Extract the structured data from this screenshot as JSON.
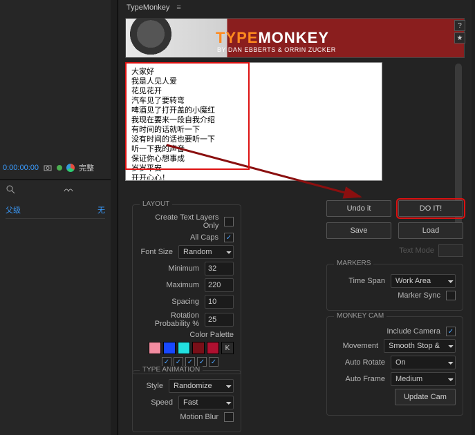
{
  "header": {
    "title": "TypeMonkey"
  },
  "banner": {
    "title_left": "TYPE",
    "title_right": "MONKEY",
    "subtitle": "BY DAN EBBERTS & ORRIN ZUCKER",
    "help": "?",
    "star": "★"
  },
  "text_content": "大家好\n我是人见人爱\n花见花开\n汽车见了要转弯\n啤酒见了打开盖的小魔红\n我现在要来一段自我介绍\n有时间的话就听一下\n没有时间的话也要听一下\n听一下我的声音\n保证你心想事成\n岁岁平安\n开开心心！",
  "layout": {
    "title": "LAYOUT",
    "create_layers_label": "Create Text Layers Only",
    "all_caps_label": "All Caps",
    "font_size_label": "Font Size",
    "font_size_value": "Random",
    "min_label": "Minimum",
    "min_value": "32",
    "max_label": "Maximum",
    "max_value": "220",
    "spacing_label": "Spacing",
    "spacing_value": "10",
    "rot_label": "Rotation Probability %",
    "rot_value": "25",
    "palette_label": "Color Palette",
    "swatches": [
      "#f28ca0",
      "#1848ff",
      "#22e0e0",
      "#7a0f18",
      "#b01030"
    ],
    "key_label": "K"
  },
  "type_anim": {
    "title": "TYPE ANIMATION",
    "style_label": "Style",
    "style_value": "Randomize",
    "speed_label": "Speed",
    "speed_value": "Fast",
    "blur_label": "Motion Blur"
  },
  "buttons": {
    "undo": "Undo it",
    "doit": "DO IT!",
    "save": "Save",
    "load": "Load",
    "text_mode": "Text Mode"
  },
  "markers": {
    "title": "MARKERS",
    "timespan_label": "Time Span",
    "timespan_value": "Work Area",
    "sync_label": "Marker Sync"
  },
  "cam": {
    "title": "MONKEY CAM",
    "include_label": "Include Camera",
    "movement_label": "Movement",
    "movement_value": "Smooth Stop & …",
    "autorotate_label": "Auto Rotate",
    "autorotate_value": "On",
    "autoframe_label": "Auto Frame",
    "autoframe_value": "Medium",
    "update_label": "Update Cam"
  },
  "left": {
    "timecode": "0:00:00:00",
    "wz": "完整",
    "parent_label": "父级",
    "none": "无"
  }
}
